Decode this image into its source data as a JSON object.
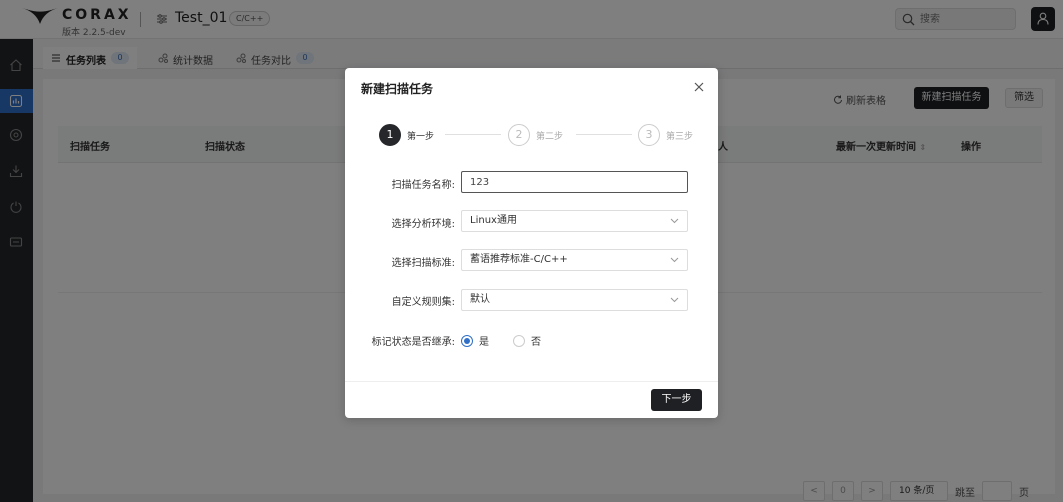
{
  "header": {
    "logo_text": "CORAX",
    "version": "版本 2.2.5-dev",
    "project_name": "Test_01",
    "language_badge": "C/C++",
    "search_placeholder": "搜索"
  },
  "sidebar": {
    "items": [
      {
        "icon": "home-icon",
        "active": false
      },
      {
        "icon": "chart-icon",
        "active": true
      },
      {
        "icon": "target-icon",
        "active": false
      },
      {
        "icon": "download-icon",
        "active": false
      },
      {
        "icon": "power-icon",
        "active": false
      },
      {
        "icon": "file-icon",
        "active": false
      }
    ]
  },
  "tabs": [
    {
      "label": "任务列表",
      "count": "0",
      "icon": "list-icon"
    },
    {
      "label": "统计数据",
      "icon": "stats-icon"
    },
    {
      "label": "任务对比",
      "count": "0",
      "icon": "compare-icon"
    }
  ],
  "toolbar": {
    "refresh_label": "刷新表格",
    "new_task_label": "新建扫描任务",
    "filter_label": "筛选"
  },
  "table": {
    "columns": [
      "扫描任务",
      "扫描状态",
      "人",
      "最新一次更新时间",
      "操作"
    ]
  },
  "pagination": {
    "prev": "<",
    "current_page": "0",
    "next": ">",
    "page_size": "10 条/页",
    "jump_label": "跳至",
    "page_suffix": "页"
  },
  "modal": {
    "title": "新建扫描任务",
    "steps": [
      {
        "number": "1",
        "label": "第一步",
        "active": true
      },
      {
        "number": "2",
        "label": "第二步",
        "active": false
      },
      {
        "number": "3",
        "label": "第三步",
        "active": false
      }
    ],
    "fields": {
      "task_name": {
        "label": "扫描任务名称:",
        "value": "123"
      },
      "environment": {
        "label": "选择分析环境:",
        "value": "Linux通用"
      },
      "standard": {
        "label": "选择扫描标准:",
        "value": "蓄语推荐标准-C/C++"
      },
      "ruleset": {
        "label": "自定义规则集:",
        "value": "默认"
      },
      "inherit": {
        "label": "标记状态是否继承:",
        "options": [
          "是",
          "否"
        ],
        "selected": "是"
      }
    },
    "next_label": "下一步"
  },
  "colors": {
    "accent": "#2f6fc8",
    "dark_button": "#1f2024",
    "sidebar_bg": "#25272b"
  }
}
